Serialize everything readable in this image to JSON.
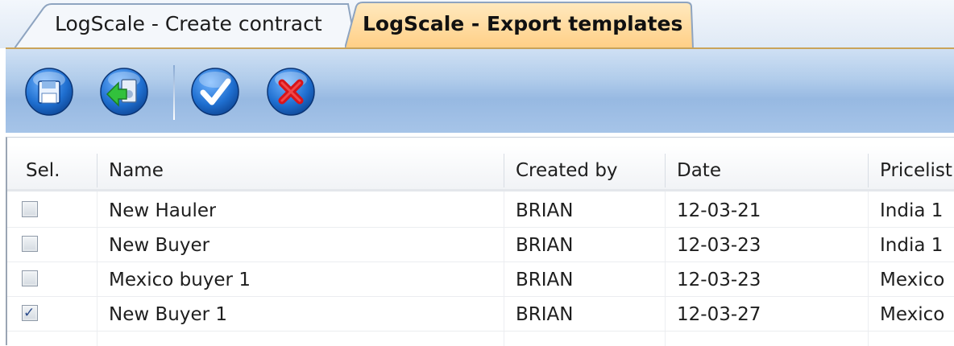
{
  "tabs": [
    {
      "label": "LogScale - Create contract",
      "active": false
    },
    {
      "label": "LogScale - Export templates",
      "active": true
    }
  ],
  "toolbar": {
    "buttons": [
      {
        "name": "save-button",
        "icon": "floppy-disk-icon"
      },
      {
        "name": "export-button",
        "icon": "export-arrow-icon"
      },
      {
        "name": "ok-button",
        "icon": "checkmark-icon"
      },
      {
        "name": "cancel-button",
        "icon": "red-x-icon"
      }
    ]
  },
  "grid": {
    "columns": [
      "Sel.",
      "Name",
      "Created by",
      "Date",
      "Pricelist"
    ],
    "rows": [
      {
        "selected": false,
        "name": "New Hauler",
        "created_by": "BRIAN",
        "date": "12-03-21",
        "pricelist": "India 1"
      },
      {
        "selected": false,
        "name": "New Buyer",
        "created_by": "BRIAN",
        "date": "12-03-23",
        "pricelist": "India 1"
      },
      {
        "selected": false,
        "name": "Mexico buyer 1",
        "created_by": "BRIAN",
        "date": "12-03-23",
        "pricelist": "Mexico"
      },
      {
        "selected": true,
        "name": "New Buyer 1",
        "created_by": "BRIAN",
        "date": "12-03-27",
        "pricelist": "Mexico"
      }
    ]
  },
  "colors": {
    "active_tab": "#ffd79a",
    "toolbar": "#a6c4e8",
    "tool_button_blue": "#1f6fd0",
    "tool_button_red": "#d8141a"
  }
}
